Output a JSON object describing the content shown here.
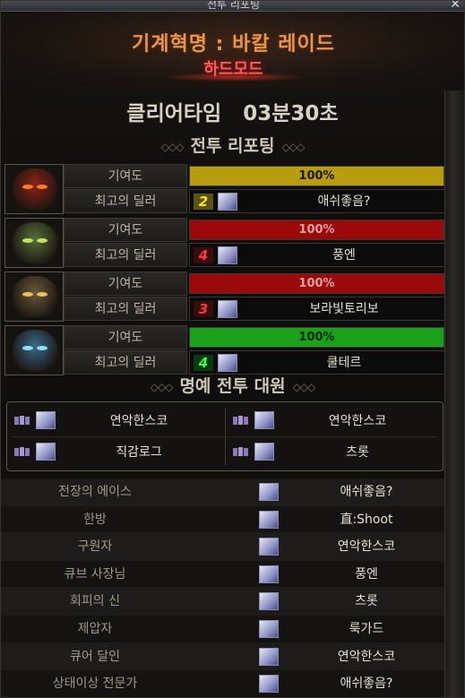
{
  "window": {
    "title": "전투 리포팅"
  },
  "header": {
    "raid_name": "기계혁명 : 바칼 레이드",
    "mode": "하드모드"
  },
  "clear_time": {
    "label": "클리어타임",
    "value": "03분30초"
  },
  "report_title": "전투 리포팅",
  "parties": [
    {
      "contribution_label": "기여도",
      "contribution_value": "100%",
      "contribution_pct": 100,
      "bar_color": "#b89c10",
      "text_color": "#1a1608",
      "dealer_label": "최고의 딜러",
      "rank": "2",
      "rank_color": "#ffe21a",
      "rank_bg": "#5a5212",
      "dealer_name": "애쉬좋음?",
      "mask_color": "#8a2414",
      "eye_color": "#ff7a2a"
    },
    {
      "contribution_label": "기여도",
      "contribution_value": "100%",
      "contribution_pct": 100,
      "bar_color": "#9a0a0a",
      "text_color": "#e0a0a0",
      "dealer_label": "최고의 딜러",
      "rank": "4",
      "rank_color": "#ff3a3a",
      "rank_bg": "#3a0c0c",
      "dealer_name": "풍엔",
      "mask_color": "#56703a",
      "eye_color": "#c6e060"
    },
    {
      "contribution_label": "기여도",
      "contribution_value": "100%",
      "contribution_pct": 100,
      "bar_color": "#9a0a0a",
      "text_color": "#e0a0a0",
      "dealer_label": "최고의 딜러",
      "rank": "3",
      "rank_color": "#ff3a3a",
      "rank_bg": "#3a0c0c",
      "dealer_name": "보라빛토리보",
      "mask_color": "#6a5a38",
      "eye_color": "#e8c060"
    },
    {
      "contribution_label": "기여도",
      "contribution_value": "100%",
      "contribution_pct": 100,
      "bar_color": "#1aa01a",
      "text_color": "#0c2a0c",
      "dealer_label": "최고의 딜러",
      "rank": "4",
      "rank_color": "#3aff4a",
      "rank_bg": "#0c3a10",
      "dealer_name": "쿨테르",
      "mask_color": "#3a6a88",
      "eye_color": "#8ae0ff"
    }
  ],
  "honor_title": "명예 전투 대원",
  "honor_members": [
    "연악한스코",
    "연악한스코",
    "직감로그",
    "츠롯"
  ],
  "awards": [
    {
      "title": "전장의 에이스",
      "name": "애쉬좋음?"
    },
    {
      "title": "한방",
      "name": "直:Shoot"
    },
    {
      "title": "구원자",
      "name": "연악한스코"
    },
    {
      "title": "큐브 사장님",
      "name": "풍엔"
    },
    {
      "title": "회피의 신",
      "name": "츠롯"
    },
    {
      "title": "제압자",
      "name": "룩가드"
    },
    {
      "title": "큐어 달인",
      "name": "연악한스코"
    },
    {
      "title": "상태이상 전문가",
      "name": "애쉬좋음?"
    }
  ],
  "icons": {
    "close": "close-icon",
    "crown": "crown-icon"
  }
}
